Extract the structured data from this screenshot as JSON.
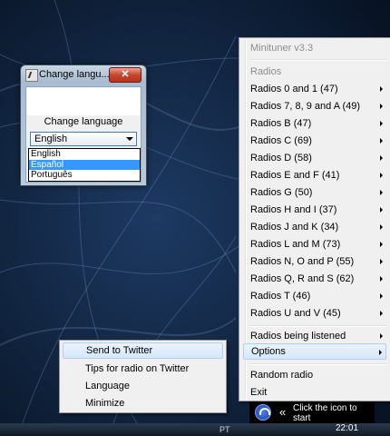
{
  "dialog": {
    "title": "Change langu...",
    "close_label": "✕",
    "label": "Change language",
    "selected": "English",
    "options": [
      "English",
      "Español",
      "Português"
    ],
    "highlighted_option": "Español"
  },
  "menu": {
    "title": "Minituner v3.3",
    "section_label": "Radios",
    "radio_groups": [
      "Radios 0 and 1 (47)",
      "Radios 7, 8, 9 and A (49)",
      "Radios B (47)",
      "Radios C (69)",
      "Radios D (58)",
      "Radios E and F (41)",
      "Radios G (50)",
      "Radios H and I (37)",
      "Radios J and K (34)",
      "Radios L and M (73)",
      "Radios N, O and P (55)",
      "Radios Q, R and S (62)",
      "Radios T (46)",
      "Radios U and V (45)"
    ],
    "listened": "Radios being listened",
    "options": "Options",
    "random": "Random radio",
    "exit": "Exit"
  },
  "submenu": {
    "items": [
      "Send to Twitter",
      "Tips for radio on Twitter",
      "Language",
      "Minimize"
    ]
  },
  "tray": {
    "text": "Click the icon to start",
    "time": "22:01",
    "lang": "PT"
  }
}
